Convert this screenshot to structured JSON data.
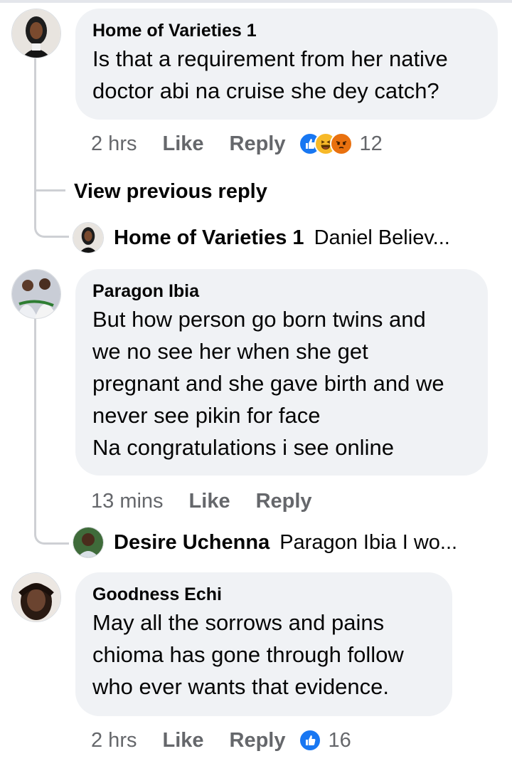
{
  "comments": [
    {
      "author": "Home of Varieties 1",
      "lines": [
        "Is that a requirement from her native",
        "doctor abi na cruise she dey catch?"
      ],
      "time": "2 hrs",
      "like": "Like",
      "reply": "Reply",
      "reactions": [
        "like",
        "haha",
        "angry"
      ],
      "reaction_count": "12"
    },
    {
      "author": "Paragon Ibia",
      "lines": [
        "But how person go born twins and",
        "we no see her when she get",
        "pregnant and she gave birth and we",
        "never see pikin for face",
        "Na congratulations i see online"
      ],
      "time": "13 mins",
      "like": "Like",
      "reply": "Reply"
    },
    {
      "author": "Goodness Echi",
      "lines": [
        "May all the sorrows and pains",
        "chioma has gone through follow",
        "who ever wants that evidence."
      ],
      "time": "2 hrs",
      "like": "Like",
      "reply": "Reply",
      "reactions": [
        "like"
      ],
      "reaction_count": "16"
    }
  ],
  "view_previous_reply": "View previous reply",
  "reply_previews": [
    {
      "author": "Home of Varieties 1",
      "snippet": "Daniel Believ..."
    },
    {
      "author": "Desire Uchenna",
      "snippet": "Paragon Ibia I wo..."
    }
  ],
  "colors": {
    "bubble": "#f0f2f5",
    "meta_text": "#65676b",
    "like_reaction": "#1877f2",
    "haha_reaction": "#f7b928",
    "angry_reaction": "#e9710f",
    "thread_line": "#ced0d4"
  }
}
